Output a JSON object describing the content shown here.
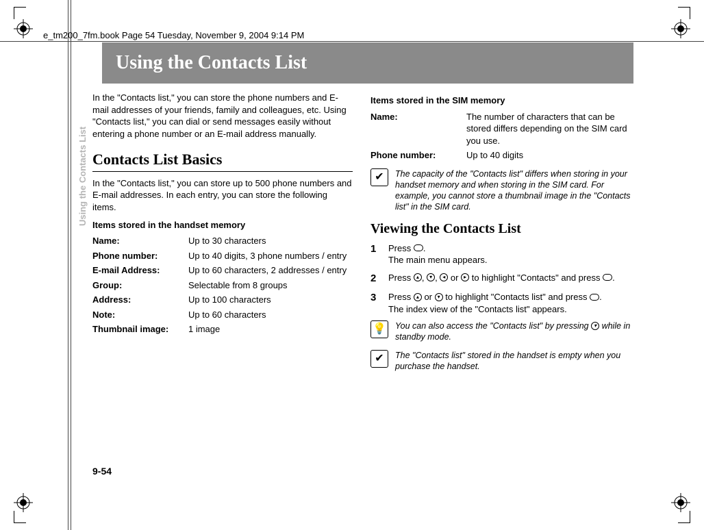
{
  "header_line": "e_tm200_7fm.book  Page 54  Tuesday, November 9, 2004  9:14 PM",
  "title": "Using the Contacts List",
  "sidebar_label": "Using the Contacts List",
  "page_number": "9-54",
  "left": {
    "intro": "In the \"Contacts list,\" you can store the phone numbers and E-mail addresses of your friends, family and colleagues, etc. Using \"Contacts list,\" you can dial or send messages easily without entering a phone number or an E-mail address manually.",
    "section_heading": "Contacts List Basics",
    "para1": "In the \"Contacts list,\" you can store up to 500 phone numbers and E-mail addresses. In each entry, you can store the following items.",
    "handset_heading": "Items stored in the handset memory",
    "handset_items": [
      {
        "label": "Name:",
        "value": "Up to 30 characters"
      },
      {
        "label": "Phone number:",
        "value": "Up to 40 digits, 3 phone numbers / entry"
      },
      {
        "label": "E-mail Address:",
        "value": "Up to 60 characters, 2 addresses / entry"
      },
      {
        "label": "Group:",
        "value": "Selectable from 8 groups"
      },
      {
        "label": "Address:",
        "value": "Up to 100 characters"
      },
      {
        "label": "Note:",
        "value": "Up to 60 characters"
      },
      {
        "label": "Thumbnail image:",
        "value": "1 image"
      }
    ]
  },
  "right": {
    "sim_heading": "Items stored in the SIM memory",
    "sim_items": [
      {
        "label": "Name:",
        "value": "The number of characters that can be stored differs depending on the SIM card you use."
      },
      {
        "label": "Phone number:",
        "value": "Up to 40 digits"
      }
    ],
    "note1": "The capacity of the \"Contacts list\" differs when storing in your handset memory and when storing in the SIM card. For example, you cannot store a thumbnail image in the \"Contacts list\" in the SIM card.",
    "subsection_heading": "Viewing the Contacts List",
    "steps": [
      {
        "num": "1",
        "text_before": "Press ",
        "text_after": ".",
        "sub": "The main menu appears."
      },
      {
        "num": "2",
        "text": "Press ◯, ◯, ◯ or ◯ to highlight \"Contacts\" and press ◯."
      },
      {
        "num": "3",
        "text": "Press ◯ or ◯ to highlight \"Contacts list\" and press ◯.",
        "sub": "The index view of the \"Contacts list\" appears."
      }
    ],
    "tip": "You can also access the \"Contacts list\" by pressing ◯ while in standby mode.",
    "note2": "The \"Contacts list\" stored in the handset is empty when you purchase the handset."
  }
}
